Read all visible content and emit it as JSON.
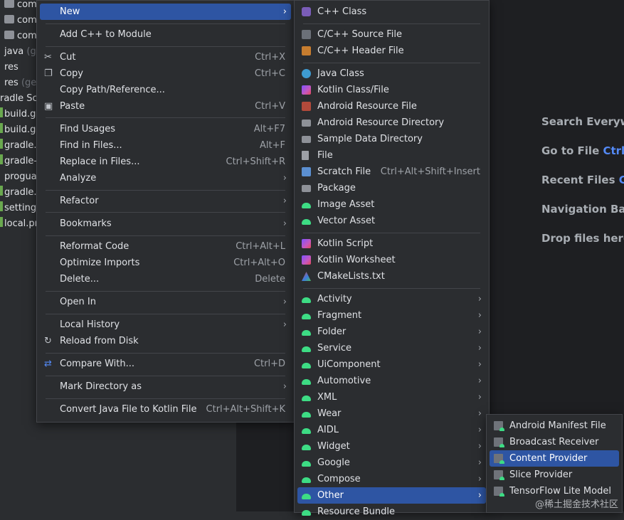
{
  "project_tree": [
    {
      "label": "com",
      "icon": "folder-icon"
    },
    {
      "label": "com",
      "icon": "folder-icon"
    },
    {
      "label": "com",
      "icon": "folder-icon"
    },
    {
      "label": "java",
      "suffix": "(ge",
      "icon": "folder-icon"
    },
    {
      "label": "res",
      "icon": "folder-icon"
    },
    {
      "label": "res",
      "suffix": "(ger",
      "icon": "folder-icon"
    },
    {
      "label": "radle Scr",
      "icon": "none"
    },
    {
      "label": "build.g",
      "icon": "gradle-file-icon"
    },
    {
      "label": "build.g",
      "icon": "gradle-file-icon"
    },
    {
      "label": "gradle.p",
      "icon": "gradle-file-icon"
    },
    {
      "label": "gradle-",
      "icon": "gradle-file-icon"
    },
    {
      "label": "progua",
      "icon": "none"
    },
    {
      "label": "gradle.p",
      "icon": "gradle-file-icon"
    },
    {
      "label": "settings",
      "icon": "gradle-file-icon"
    },
    {
      "label": "local.pr",
      "icon": "gradle-file-icon"
    }
  ],
  "editor_hints": {
    "search": "Search Everywh",
    "goto_label": "Go to File",
    "goto_key": "Ctrl+",
    "recent_label": "Recent Files",
    "recent_key": "Ct",
    "nav": "Navigation Bar",
    "drop": "Drop files here"
  },
  "context_menu": {
    "new": "New",
    "add_cpp": "Add C++ to Module",
    "cut": "Cut",
    "cut_sc": "Ctrl+X",
    "copy": "Copy",
    "copy_sc": "Ctrl+C",
    "copy_path": "Copy Path/Reference...",
    "paste": "Paste",
    "paste_sc": "Ctrl+V",
    "find_usages": "Find Usages",
    "find_usages_sc": "Alt+F7",
    "find_in_files": "Find in Files...",
    "find_in_files_sc": "Alt+F",
    "replace_in_files": "Replace in Files...",
    "replace_in_files_sc": "Ctrl+Shift+R",
    "analyze": "Analyze",
    "refactor": "Refactor",
    "bookmarks": "Bookmarks",
    "reformat": "Reformat Code",
    "reformat_sc": "Ctrl+Alt+L",
    "optimize": "Optimize Imports",
    "optimize_sc": "Ctrl+Alt+O",
    "delete": "Delete...",
    "delete_sc": "Delete",
    "open_in": "Open In",
    "local_history": "Local History",
    "reload": "Reload from Disk",
    "compare": "Compare With...",
    "compare_sc": "Ctrl+D",
    "mark_dir": "Mark Directory as",
    "convert": "Convert Java File to Kotlin File",
    "convert_sc": "Ctrl+Alt+Shift+K"
  },
  "new_menu": {
    "cpp_class": "C++ Class",
    "cpp_source": "C/C++ Source File",
    "cpp_header": "C/C++ Header File",
    "java_class": "Java Class",
    "kotlin_class": "Kotlin Class/File",
    "android_res_file": "Android Resource File",
    "android_res_dir": "Android Resource Directory",
    "sample_data": "Sample Data Directory",
    "file": "File",
    "scratch": "Scratch File",
    "scratch_sc": "Ctrl+Alt+Shift+Insert",
    "package": "Package",
    "image_asset": "Image Asset",
    "vector_asset": "Vector Asset",
    "kotlin_script": "Kotlin Script",
    "kotlin_worksheet": "Kotlin Worksheet",
    "cmake": "CMakeLists.txt",
    "activity": "Activity",
    "fragment": "Fragment",
    "folder": "Folder",
    "service": "Service",
    "uicomponent": "UiComponent",
    "automotive": "Automotive",
    "xml": "XML",
    "wear": "Wear",
    "aidl": "AIDL",
    "widget": "Widget",
    "google": "Google",
    "compose": "Compose",
    "other": "Other",
    "resource_bundle": "Resource Bundle"
  },
  "other_menu": {
    "manifest": "Android Manifest File",
    "broadcast": "Broadcast Receiver",
    "content_provider": "Content Provider",
    "slice": "Slice Provider",
    "tflite": "TensorFlow Lite Model"
  },
  "watermark": "@稀土掘金技术社区",
  "colors": {
    "selection": "#2e55a3",
    "menu_bg": "#2b2d30",
    "android_green": "#3ddc84",
    "link_blue": "#548af7"
  }
}
